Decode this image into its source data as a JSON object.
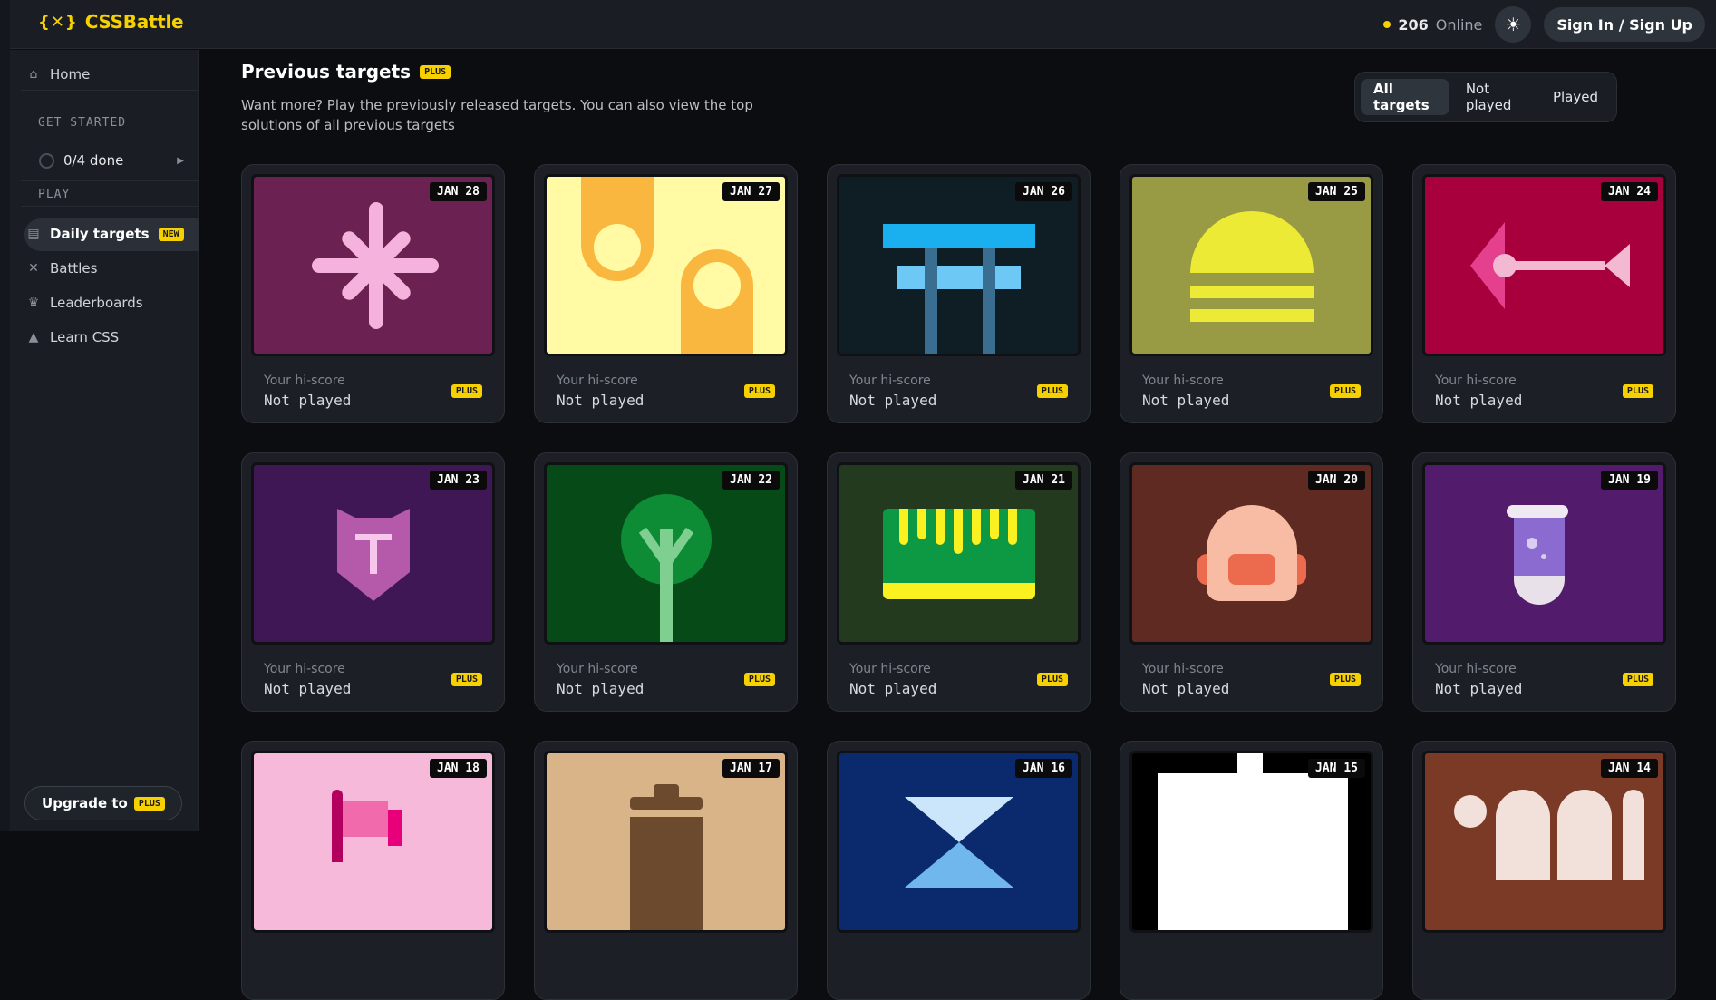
{
  "app": {
    "logo_mark": "{✕}",
    "logo_text": "CSSBattle"
  },
  "header": {
    "online_count": "206",
    "online_label": "Online",
    "theme_icon": "sun-icon",
    "signin_label": "Sign In / Sign Up"
  },
  "sidebar": {
    "home": "Home",
    "get_started": "GET STARTED",
    "progress": "0/4 done",
    "play": "PLAY",
    "daily": "Daily targets",
    "daily_badge": "NEW",
    "battles": "Battles",
    "leaderboards": "Leaderboards",
    "learn": "Learn CSS",
    "upgrade": "Upgrade to",
    "upgrade_badge": "PLUS"
  },
  "main": {
    "title": "Previous targets",
    "title_badge": "PLUS",
    "description": "Want more? Play the previously released targets. You can also view the top solutions of all previous targets",
    "filters": [
      "All targets",
      "Not played",
      "Played"
    ],
    "active_filter": "All targets"
  },
  "cards": [
    {
      "date": "JAN 28",
      "label": "Your hi-score",
      "value": "Not played",
      "badge": "PLUS",
      "bg": "#6b2151"
    },
    {
      "date": "JAN 27",
      "label": "Your hi-score",
      "value": "Not played",
      "badge": "PLUS",
      "bg": "#fffaa3"
    },
    {
      "date": "JAN 26",
      "label": "Your hi-score",
      "value": "Not played",
      "badge": "PLUS",
      "bg": "#0e1e24"
    },
    {
      "date": "JAN 25",
      "label": "Your hi-score",
      "value": "Not played",
      "badge": "PLUS",
      "bg": "#999a44"
    },
    {
      "date": "JAN 24",
      "label": "Your hi-score",
      "value": "Not played",
      "badge": "PLUS",
      "bg": "#a8003c"
    },
    {
      "date": "JAN 23",
      "label": "Your hi-score",
      "value": "Not played",
      "badge": "PLUS",
      "bg": "#3e1754"
    },
    {
      "date": "JAN 22",
      "label": "Your hi-score",
      "value": "Not played",
      "badge": "PLUS",
      "bg": "#054a17"
    },
    {
      "date": "JAN 21",
      "label": "Your hi-score",
      "value": "Not played",
      "badge": "PLUS",
      "bg": "#233a1e"
    },
    {
      "date": "JAN 20",
      "label": "Your hi-score",
      "value": "Not played",
      "badge": "PLUS",
      "bg": "#5e2a22"
    },
    {
      "date": "JAN 19",
      "label": "Your hi-score",
      "value": "Not played",
      "badge": "PLUS",
      "bg": "#531b6b"
    },
    {
      "date": "JAN 18",
      "label": "",
      "value": "",
      "badge": "",
      "bg": "#f6b9d9"
    },
    {
      "date": "JAN 17",
      "label": "",
      "value": "",
      "badge": "",
      "bg": "#d9b489"
    },
    {
      "date": "JAN 16",
      "label": "",
      "value": "",
      "badge": "",
      "bg": "#0b2a6e"
    },
    {
      "date": "JAN 15",
      "label": "",
      "value": "",
      "badge": "",
      "bg": "#000000"
    },
    {
      "date": "JAN 14",
      "label": "",
      "value": "",
      "badge": "",
      "bg": "#7a3a26"
    }
  ]
}
